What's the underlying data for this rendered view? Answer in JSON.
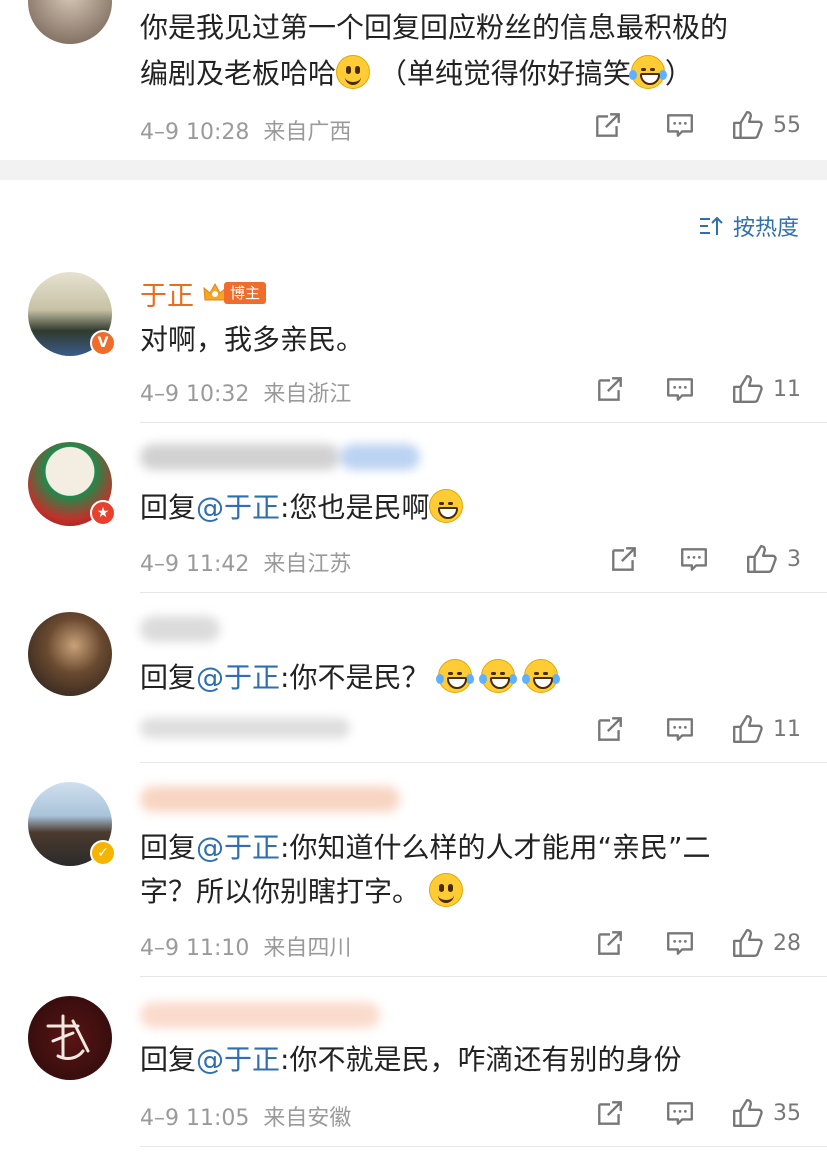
{
  "colors": {
    "accent": "#2d6fb0",
    "username": "#ea6c1d",
    "vip": "#f06c2b",
    "meta": "#9a9a9a"
  },
  "top_comment": {
    "text_line1": "你是我见过第一个回复回应粉丝的信息最积极的",
    "text_line2_a": "编剧及老板哈哈",
    "text_line2_b": " （单纯觉得你好搞笑",
    "text_line2_c": "）",
    "time": "4–9 10:28",
    "location": "来自广西",
    "likes": "55"
  },
  "sort": {
    "label": "按热度",
    "icon": "sort-icon"
  },
  "comments": [
    {
      "username": "于正",
      "badge_label": "博主",
      "text": "对啊，我多亲民。",
      "time": "4–9 10:32",
      "location": "来自浙江",
      "likes": "11"
    },
    {
      "reply_prefix": "回复",
      "mention": "@于正",
      "text": ":您也是民啊",
      "time": "4–9 11:42",
      "location": "来自江苏",
      "likes": "3"
    },
    {
      "reply_prefix": "回复",
      "mention": "@于正",
      "text": ":你不是民？",
      "likes": "11"
    },
    {
      "reply_prefix": "回复",
      "mention": "@于正",
      "text": ":你知道什么样的人才能用“亲民”二",
      "text_line2": "字？所以你别瞎打字。",
      "time": "4–9 11:10",
      "location": "来自四川",
      "likes": "28"
    },
    {
      "reply_prefix": "回复",
      "mention": "@于正",
      "text": ":你不就是民，咋滴还有别的身份",
      "time": "4–9 11:05",
      "location": "来自安徽",
      "likes": "35"
    }
  ]
}
